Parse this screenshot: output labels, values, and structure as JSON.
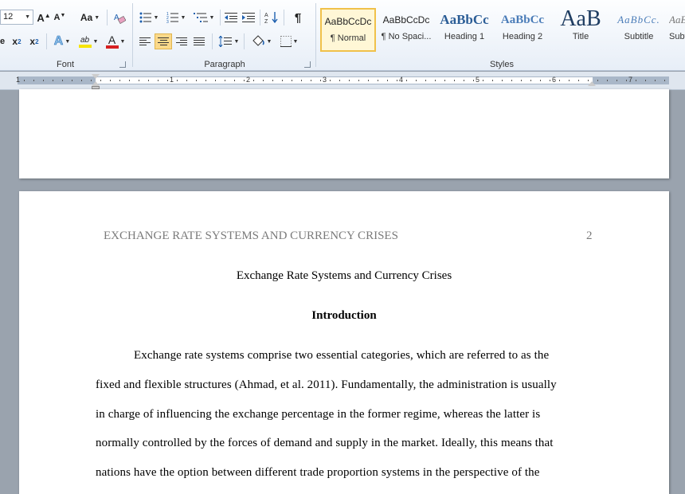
{
  "ribbon": {
    "font_group": {
      "label": "Font",
      "font_size": "12",
      "grow_font": "A",
      "shrink_font": "A",
      "change_case": "Aa",
      "subscript": "x",
      "subscript_mark": "2",
      "superscript": "x",
      "superscript_mark": "2",
      "text_effects": "A",
      "highlight": "ab",
      "font_color": "A"
    },
    "paragraph_group": {
      "label": "Paragraph",
      "show_marks": "¶"
    },
    "styles_group": {
      "label": "Styles",
      "items": [
        {
          "sample": "AaBbCcDc",
          "name": "¶ Normal"
        },
        {
          "sample": "AaBbCcDc",
          "name": "¶ No Spaci..."
        },
        {
          "sample": "AaBbCc",
          "name": "Heading 1"
        },
        {
          "sample": "AaBbCc",
          "name": "Heading 2"
        },
        {
          "sample": "AaB",
          "name": "Title"
        },
        {
          "sample": "AaBbCc.",
          "name": "Subtitle"
        },
        {
          "sample": "AaB",
          "name": "Subt"
        }
      ]
    },
    "colors": {
      "highlight": "#f7e400",
      "font_color": "#d62020",
      "selected": "#fbd98a"
    }
  },
  "ruler": {
    "numbers": [
      "1",
      "1",
      "2",
      "3",
      "4",
      "5",
      "6",
      "7"
    ]
  },
  "document": {
    "running_head": "EXCHANGE RATE SYSTEMS AND CURRENCY CRISES",
    "page_number": "2",
    "title": "Exchange Rate Systems and Currency Crises",
    "heading": "Introduction",
    "lines": [
      "Exchange rate systems comprise two essential categories, which are referred to as the",
      "fixed and flexible structures (Ahmad, et al. 2011). Fundamentally, the administration is usually",
      "in charge of influencing the exchange percentage in the former regime, whereas the latter is",
      "normally controlled by the forces of demand and supply in the market. Ideally, this means that",
      "nations have the option between different trade proportion systems in the perspective of the"
    ]
  }
}
